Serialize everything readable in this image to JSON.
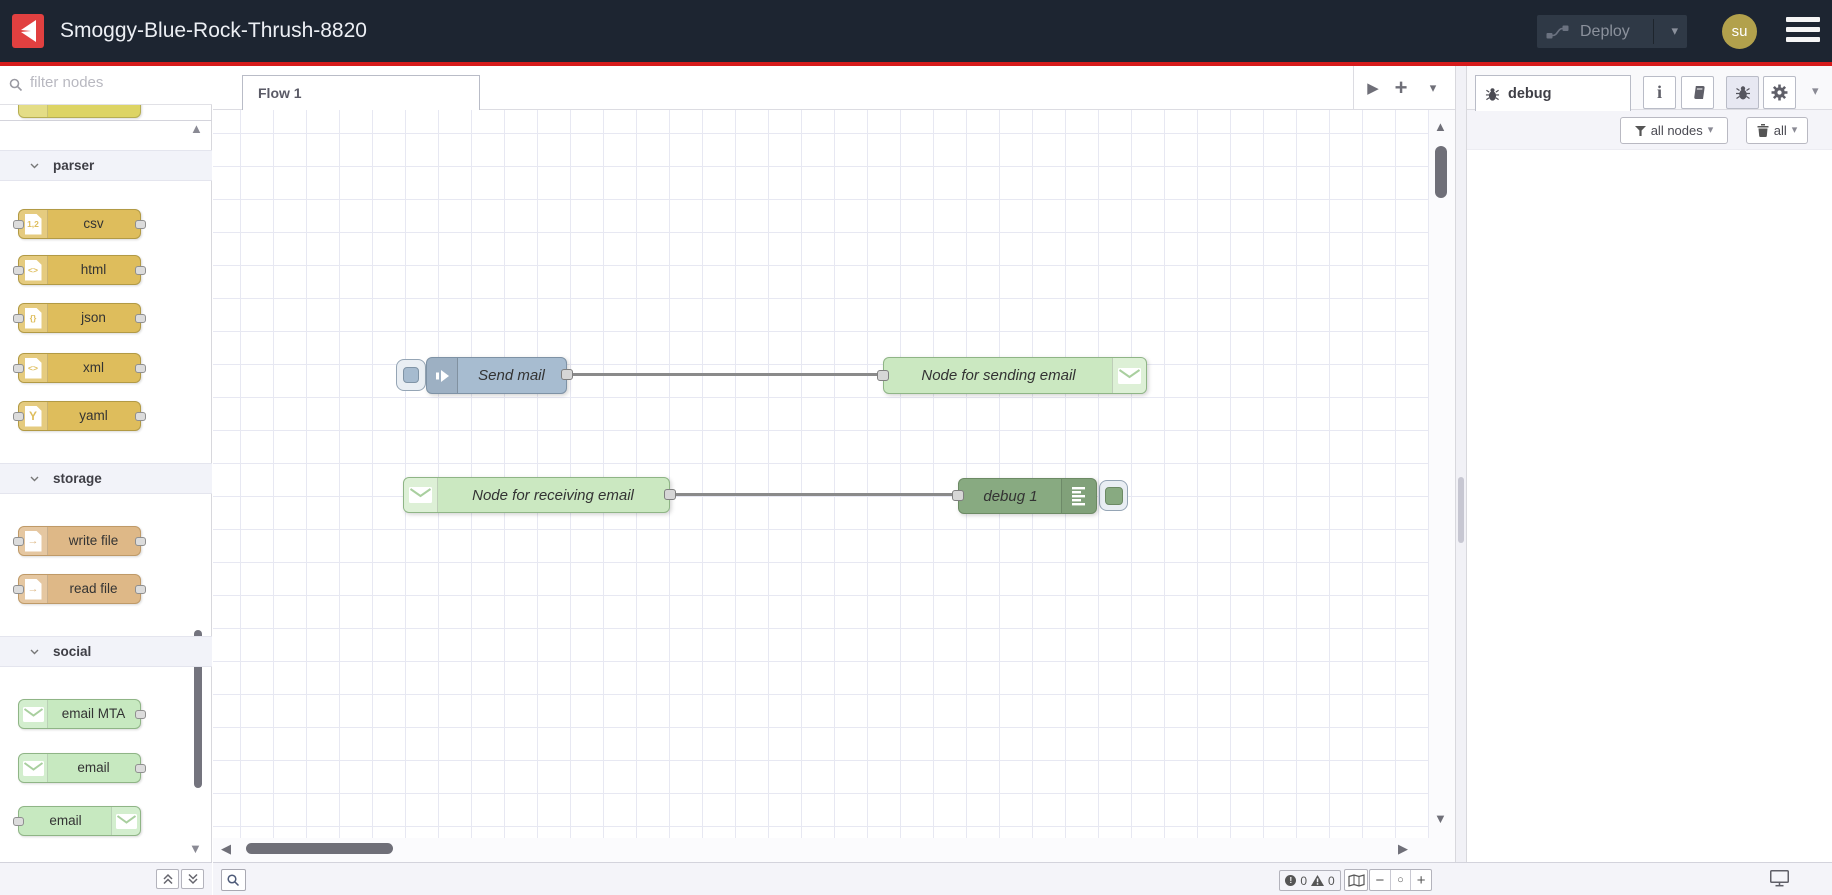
{
  "header": {
    "title": "Smoggy-Blue-Rock-Thrush-8820",
    "deploy_label": "Deploy",
    "avatar_text": "su"
  },
  "palette": {
    "search_placeholder": "filter nodes",
    "categories": [
      {
        "label": "parser",
        "items": [
          {
            "label": "csv",
            "icon": "file-icon",
            "glyph": "1,2"
          },
          {
            "label": "html",
            "icon": "file-icon",
            "glyph": "<>"
          },
          {
            "label": "json",
            "icon": "file-icon",
            "glyph": "{}"
          },
          {
            "label": "xml",
            "icon": "file-icon",
            "glyph": "<>"
          },
          {
            "label": "yaml",
            "icon": "file-icon",
            "glyph": "Y"
          }
        ]
      },
      {
        "label": "storage",
        "items": [
          {
            "label": "write file",
            "icon": "file-arrow-icon",
            "glyph": "→"
          },
          {
            "label": "read file",
            "icon": "file-arrow-icon",
            "glyph": "→"
          }
        ]
      },
      {
        "label": "social",
        "items": [
          {
            "label": "email MTA",
            "icon": "envelope-icon"
          },
          {
            "label": "email",
            "icon": "envelope-icon"
          },
          {
            "label": "email",
            "icon": "envelope-icon"
          }
        ]
      }
    ]
  },
  "workspace": {
    "tab_label": "Flow 1",
    "nodes": [
      {
        "label": "Send mail",
        "type": "inject"
      },
      {
        "label": "Node for sending email",
        "type": "email out"
      },
      {
        "label": "Node for receiving email",
        "type": "email in"
      },
      {
        "label": "debug 1",
        "type": "debug"
      }
    ]
  },
  "sidebar": {
    "tab_label": "debug",
    "filter_label": "all nodes",
    "clear_label": "all"
  },
  "statusbar": {
    "error_count": "0",
    "warning_count": "0"
  },
  "colors": {
    "header_bg": "#1d2531",
    "accent_red": "#d61b1b",
    "inject_node": "#a6bbcf",
    "email_node": "#c7e9c0",
    "debug_node": "#87a980",
    "parser_node": "#debd5c",
    "storage_node": "#deb887",
    "sequence_node": "#e2d96e",
    "avatar_bg": "#b2a14c"
  }
}
